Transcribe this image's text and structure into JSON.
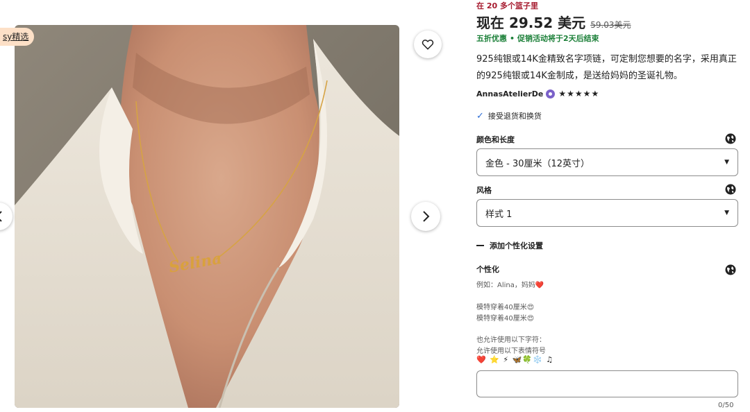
{
  "gallery": {
    "badge": "sy精选",
    "necklace_text": "Selina"
  },
  "listing": {
    "basket_note": "在 20 多个篮子里",
    "price_now": "现在 29.52 美元",
    "price_old": "59.03美元",
    "sale_discount": "五折优惠",
    "sale_dot": "•",
    "sale_ending": "促销活动将于2天后结束",
    "description": "925纯银或14K金精致名字项链，可定制您想要的名字，采用真正的925纯银或14K金制成，是送给妈妈的圣诞礼物。",
    "seller": "AnnasAtelierDe",
    "stars": "★★★★★",
    "returns": "接受退货和换货"
  },
  "options": {
    "color_label": "颜色和长度",
    "color_value": "金色 - 30厘米（12英寸）",
    "style_label": "风格",
    "style_value": "样式 1",
    "caret": "▼"
  },
  "personalization": {
    "toggle": "添加个性化设置",
    "title": "个性化",
    "example": "例如：Alina，妈妈❤️",
    "model_note_1": "模特穿着40厘米😍",
    "model_note_2": "模特穿着40厘米😍",
    "allowed_chars": "也允许使用以下字符：",
    "allowed_emoji": "允许使用以下表情符号",
    "emoji_list": "❤️ ⭐ ⚡ 🦋🍀❄️ ♫",
    "counter": "0/50"
  },
  "colors": {
    "sale_green": "#1a7f37",
    "basket_red": "#a61a2e",
    "badge_bg": "#fde0c7",
    "check_blue": "#2f6fd6"
  },
  "icons": [
    "heart-icon",
    "chevron-right-icon",
    "chevron-left-icon",
    "globe-icon",
    "check-icon",
    "minus-icon"
  ]
}
